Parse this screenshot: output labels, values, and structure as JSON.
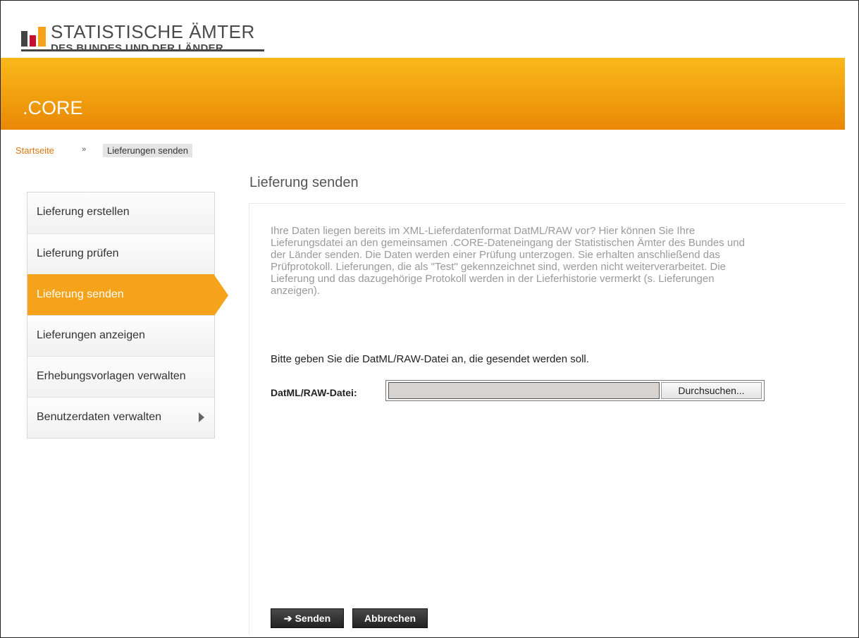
{
  "header": {
    "logo_title": "STATISTISCHE ÄMTER",
    "logo_subtitle": "DES BUNDES UND DER LÄNDER",
    "app_title": ".CORE",
    "colors": {
      "banner": "#f1a10f",
      "accent": "#f6a31c",
      "bar_gray": "#444444",
      "bar_red": "#c8102e",
      "bar_gold": "#f6a31c"
    }
  },
  "breadcrumb": {
    "home": "Startseite",
    "separator": "»",
    "current": "Lieferungen senden"
  },
  "sidebar": {
    "items": [
      {
        "label": "Lieferung erstellen",
        "active": false
      },
      {
        "label": "Lieferung prüfen",
        "active": false
      },
      {
        "label": "Lieferung senden",
        "active": true
      },
      {
        "label": "Lieferungen anzeigen",
        "active": false
      },
      {
        "label": "Erhebungsvorlagen verwalten",
        "active": false
      },
      {
        "label": "Benutzerdaten verwalten",
        "active": false,
        "has_submenu": true
      }
    ]
  },
  "main": {
    "title": "Lieferung senden",
    "description": "Ihre Daten liegen bereits im XML-Lieferdatenformat DatML/RAW vor? Hier können Sie Ihre Lieferungsdatei an den gemeinsamen .CORE-Dateneingang der Statistischen Ämter des Bundes und der Länder senden. Die Daten werden einer Prüfung unterzogen. Sie erhalten anschließend das Prüfprotokoll. Lieferungen, die als \"Test\" gekennzeichnet sind, werden nicht weiterverarbeitet. Die Lieferung und das dazugehörige Protokoll werden in der Lieferhistorie vermerkt (s. Lieferungen anzeigen).",
    "instruction": "Bitte geben Sie die DatML/RAW-Datei an, die gesendet werden soll.",
    "file_label": "DatML/RAW-Datei:",
    "file_value": "",
    "browse_label": "Durchsuchen...",
    "send_label": "Senden",
    "cancel_label": "Abbrechen"
  }
}
